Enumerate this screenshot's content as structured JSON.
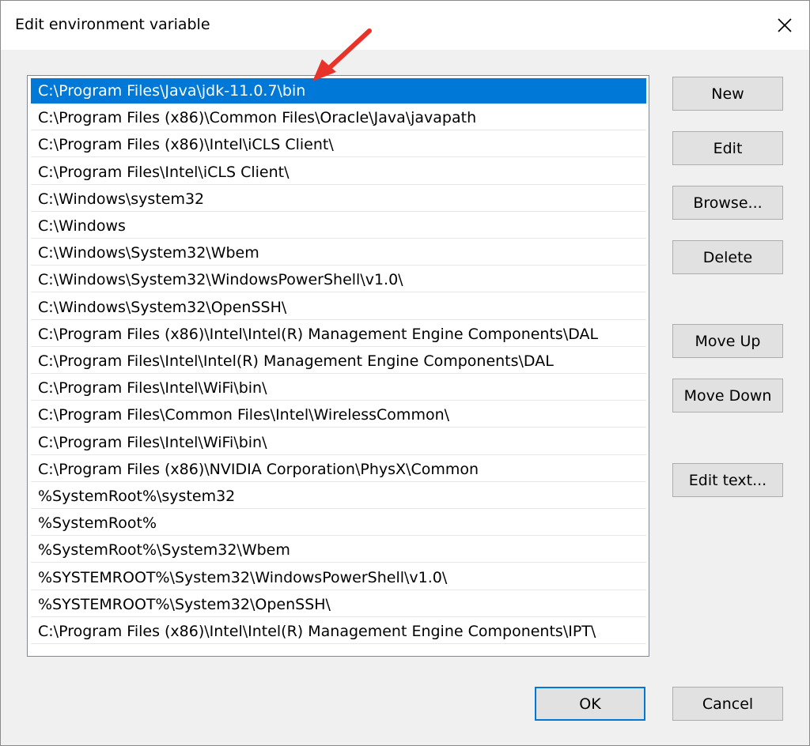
{
  "window": {
    "title": "Edit environment variable",
    "close_label": "✕"
  },
  "list": {
    "selected_index": 0,
    "items": [
      "C:\\Program Files\\Java\\jdk-11.0.7\\bin",
      "C:\\Program Files (x86)\\Common Files\\Oracle\\Java\\javapath",
      "C:\\Program Files (x86)\\Intel\\iCLS Client\\",
      "C:\\Program Files\\Intel\\iCLS Client\\",
      "C:\\Windows\\system32",
      "C:\\Windows",
      "C:\\Windows\\System32\\Wbem",
      "C:\\Windows\\System32\\WindowsPowerShell\\v1.0\\",
      "C:\\Windows\\System32\\OpenSSH\\",
      "C:\\Program Files (x86)\\Intel\\Intel(R) Management Engine Components\\DAL",
      "C:\\Program Files\\Intel\\Intel(R) Management Engine Components\\DAL",
      "C:\\Program Files\\Intel\\WiFi\\bin\\",
      "C:\\Program Files\\Common Files\\Intel\\WirelessCommon\\",
      "C:\\Program Files\\Intel\\WiFi\\bin\\",
      "C:\\Program Files (x86)\\NVIDIA Corporation\\PhysX\\Common",
      "%SystemRoot%\\system32",
      "%SystemRoot%",
      "%SystemRoot%\\System32\\Wbem",
      "%SYSTEMROOT%\\System32\\WindowsPowerShell\\v1.0\\",
      "%SYSTEMROOT%\\System32\\OpenSSH\\",
      "C:\\Program Files (x86)\\Intel\\Intel(R) Management Engine Components\\IPT\\"
    ]
  },
  "buttons": {
    "new": "New",
    "edit": "Edit",
    "browse": "Browse...",
    "delete": "Delete",
    "move_up": "Move Up",
    "move_down": "Move Down",
    "edit_text": "Edit text...",
    "ok": "OK",
    "cancel": "Cancel"
  },
  "colors": {
    "selection": "#0078d7",
    "annotation_arrow": "#e8332a"
  }
}
